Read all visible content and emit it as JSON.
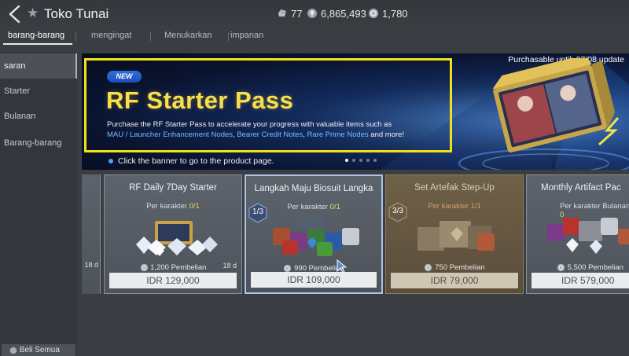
{
  "header": {
    "title": "Toko Tunai",
    "currencies": [
      {
        "icon": "crystal-icon",
        "value": "77"
      },
      {
        "icon": "gem-icon",
        "value": "6,865,493"
      },
      {
        "icon": "coin-icon",
        "value": "1,780"
      }
    ]
  },
  "tabs": [
    {
      "label": "barang-barang",
      "active": true
    },
    {
      "label": "mengingat",
      "active": false
    },
    {
      "label": "Menukarkan",
      "active": false
    },
    {
      "label": "impanan",
      "active": false
    }
  ],
  "sidebar": {
    "items": [
      {
        "label": "saran",
        "active": true
      },
      {
        "label": "Starter",
        "active": false
      },
      {
        "label": "Bulanan",
        "active": false
      },
      {
        "label": "Barang-barang",
        "active": false
      }
    ]
  },
  "banner": {
    "badge": "NEW",
    "title": "RF Starter Pass",
    "purchasable": "Purchasable until: 07/08 update",
    "desc_line1": "Purchase the RF Starter Pass to accelerate your progress with valuable items such as",
    "desc_hl1": "MAU / Launcher Enhancement Nodes",
    "desc_sep1": ", ",
    "desc_hl2": "Bearer Credit Notes",
    "desc_sep2": ", ",
    "desc_hl3": "Rare Prime Nodes",
    "desc_end": " and more!",
    "hint": "Click the banner to go to the product page.",
    "highlight_color": "#f2e11a",
    "title_color": "#f7e04a"
  },
  "cards": {
    "partial_left": {
      "days": "18 d"
    },
    "items": [
      {
        "title": "RF Daily 7Day Starter",
        "limit_label": "Per karakter",
        "limit_count": "0/1",
        "bonus_value": "1,200",
        "bonus_label": "Pembelian",
        "price": "IDR 129,000",
        "days": "18 d",
        "badge": ""
      },
      {
        "title": "Langkah Maju Biosuit Langka",
        "limit_label": "Per karakter",
        "limit_count": "0/1",
        "bonus_value": "990",
        "bonus_label": "Pembelian",
        "price": "IDR 109,000",
        "days": "",
        "badge": "1/3"
      },
      {
        "title": "Set Artefak Step-Up",
        "limit_label": "Per karakter",
        "limit_count": "1/1",
        "bonus_value": "750",
        "bonus_label": "Pembelian",
        "price": "IDR 79,000",
        "days": "",
        "badge": "3/3"
      },
      {
        "title": "Monthly Artifact Pac",
        "limit_label": "Per karakter Bulanan",
        "limit_count": "0",
        "bonus_value": "5,500",
        "bonus_label": "Pembelian",
        "price": "IDR 579,000",
        "days": "",
        "badge": ""
      }
    ]
  },
  "footer": {
    "buy_all": "Beli Semua"
  }
}
